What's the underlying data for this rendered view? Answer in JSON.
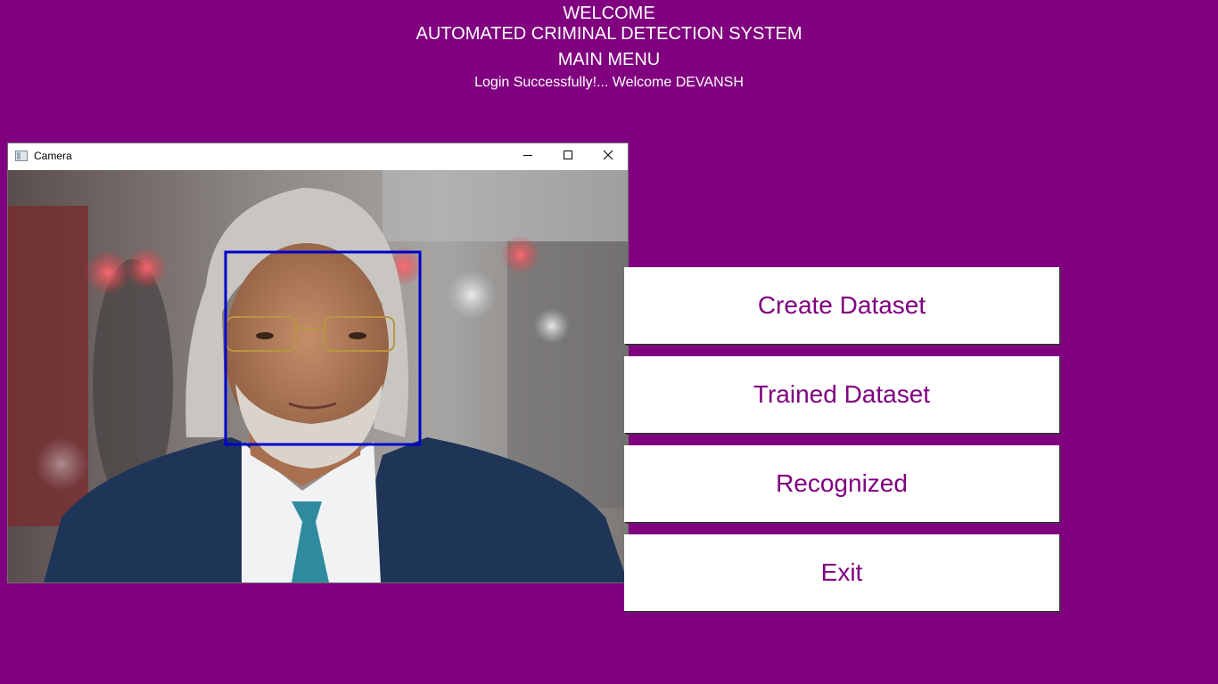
{
  "header": {
    "welcome": "WELCOME",
    "system_title": "AUTOMATED CRIMINAL DETECTION SYSTEM",
    "main_menu": "MAIN MENU",
    "login_message": "Login Successfully!... Welcome DEVANSH"
  },
  "menu": {
    "create_dataset": "Create Dataset",
    "trained_dataset": "Trained Dataset",
    "recognized": "Recognized",
    "exit": "Exit"
  },
  "camera_window": {
    "title": "Camera",
    "icons": {
      "app": "window-app-icon",
      "minimize": "minimize-icon",
      "maximize": "maximize-icon",
      "close": "close-icon"
    },
    "detection_box_color": "#0000cc"
  },
  "colors": {
    "background": "#800080",
    "header_text": "#ffffff",
    "button_text": "#800080",
    "button_bg": "#ffffff"
  }
}
